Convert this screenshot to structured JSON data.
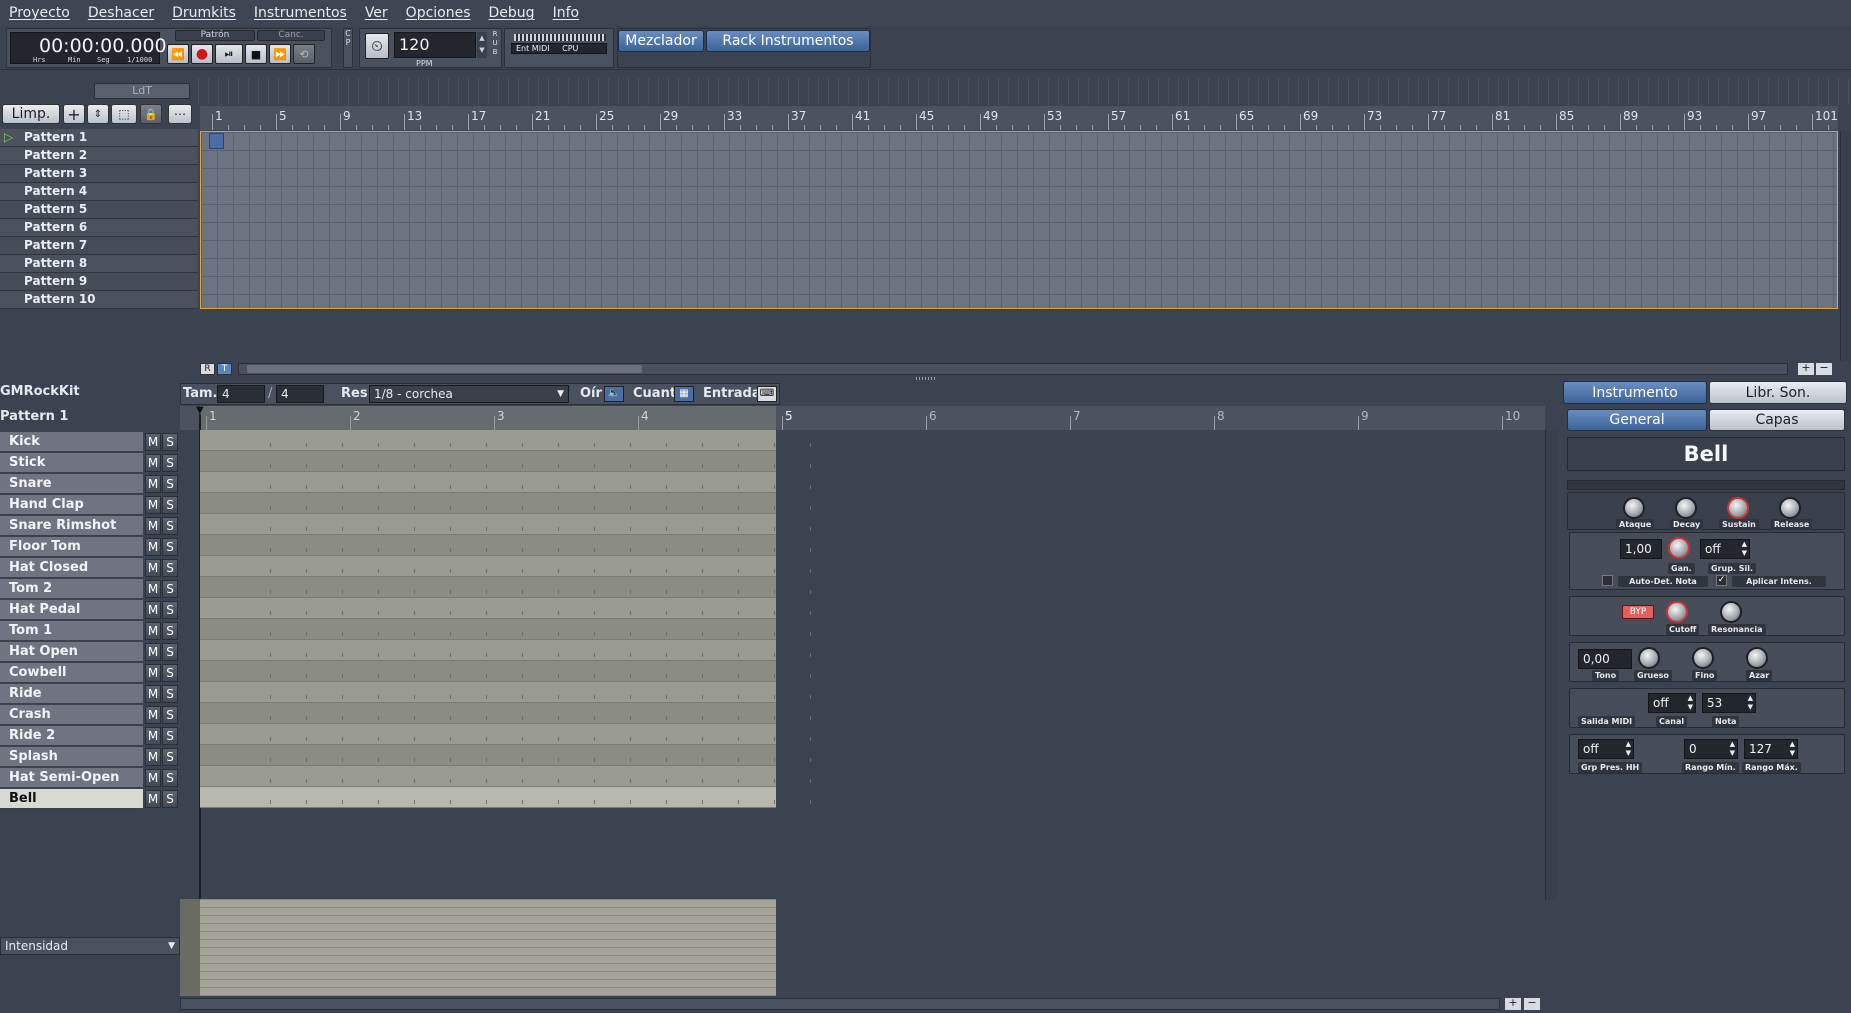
{
  "menu": [
    "Proyecto",
    "Deshacer",
    "Drumkits",
    "Instrumentos",
    "Ver",
    "Opciones",
    "Debug",
    "Info"
  ],
  "transport": {
    "time": "00:00:00.000",
    "time_units": [
      "Hrs",
      "Min",
      "Seg",
      "1/1000"
    ],
    "mode_pattern": "Patrón",
    "mode_song": "Canc.",
    "bpm": "120",
    "bpm_unit": "PPM",
    "cp_label": "C P",
    "rub_label": "R U B",
    "midi_in": "Ent MIDI",
    "cpu": "CPU"
  },
  "top_buttons": {
    "mixer": "Mezclador",
    "rack": "Rack Instrumentos"
  },
  "song_editor": {
    "ldt": "LdT",
    "clear": "Limp.",
    "patterns": [
      "Pattern 1",
      "Pattern 2",
      "Pattern 3",
      "Pattern 4",
      "Pattern 5",
      "Pattern 6",
      "Pattern 7",
      "Pattern 8",
      "Pattern 9",
      "Pattern 10"
    ],
    "ruler": [
      "1",
      "5",
      "9",
      "13",
      "17",
      "21",
      "25",
      "29",
      "33",
      "37",
      "41",
      "45",
      "49",
      "53",
      "57",
      "61",
      "65",
      "69",
      "73",
      "77",
      "81",
      "85",
      "89",
      "93",
      "97",
      "101"
    ],
    "r_btn": "R",
    "t_btn": "T"
  },
  "pattern_editor": {
    "drumkit": "GMRockKit",
    "pattern": "Pattern 1",
    "size_label": "Tam.",
    "size_num": "4",
    "size_den": "4",
    "res_label": "Res",
    "res_value": "1/8 - corchea",
    "hear_label": "Oír",
    "quant_label": "Cuant",
    "input_label": "Entrada",
    "ruler": [
      "1",
      "2",
      "3",
      "4",
      "5",
      "6",
      "7",
      "8",
      "9",
      "10"
    ],
    "mute": "M",
    "solo": "S",
    "instruments": [
      "Kick",
      "Stick",
      "Snare",
      "Hand Clap",
      "Snare Rimshot",
      "Floor Tom",
      "Hat Closed",
      "Tom 2",
      "Hat Pedal",
      "Tom 1",
      "Hat Open",
      "Cowbell",
      "Ride",
      "Crash",
      "Ride 2",
      "Splash",
      "Hat Semi-Open",
      "Bell"
    ],
    "velocity_select": "Intensidad"
  },
  "rack": {
    "tab_instrument": "Instrumento",
    "tab_library": "Libr. Son.",
    "tab_general": "General",
    "tab_layers": "Capas",
    "instrument_name": "Bell",
    "adsr": [
      "Ataque",
      "Decay",
      "Sustain",
      "Release"
    ],
    "gain_value": "1,00",
    "gain_label": "Gan.",
    "mute_group_value": "off",
    "mute_group_label": "Grup. Sil.",
    "auto_stop": "Auto-Det. Nota",
    "apply_velocity": "Aplicar Intens.",
    "bypass": "BYP",
    "cutoff": "Cutoff",
    "resonance": "Resonancia",
    "pitch_value": "0,00",
    "pitch_label": "Tono",
    "coarse": "Grueso",
    "fine": "Fino",
    "random": "Azar",
    "midi_out": "Salida MIDI",
    "channel_value": "off",
    "channel_label": "Canal",
    "note_value": "53",
    "note_label": "Nota",
    "hh_group_value": "off",
    "hh_group_label": "Grp Pres. HH",
    "min_range_value": "0",
    "min_range_label": "Rango Mín.",
    "max_range_value": "127",
    "max_range_label": "Rango Máx."
  },
  "colors": {
    "accent": "#e0a43a",
    "blue": "#4a70a8",
    "grid": "#6c7381",
    "pattern": "#98998d"
  }
}
